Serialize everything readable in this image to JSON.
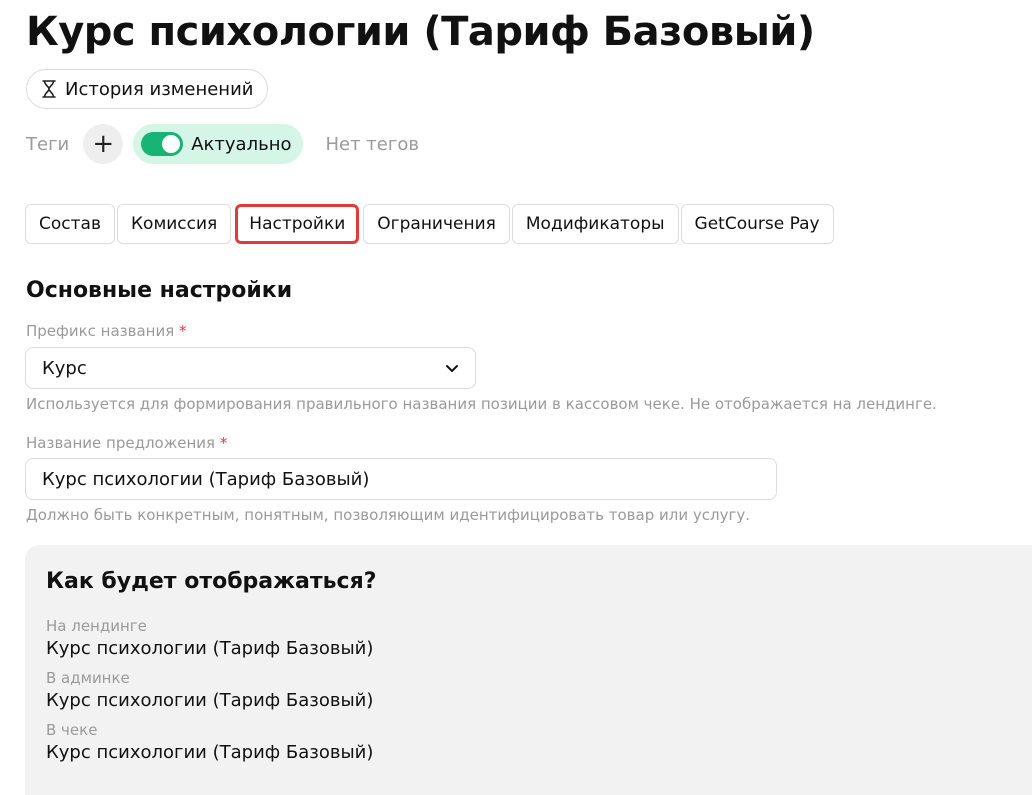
{
  "page": {
    "title": "Курс психологии (Тариф Базовый)"
  },
  "history": {
    "label": "История изменений",
    "icon": "hourglass-icon"
  },
  "tags": {
    "label": "Теги",
    "add_symbol": "+",
    "status_label": "Актуально",
    "status_on": true,
    "empty_text": "Нет тегов",
    "accent_color": "#18b476"
  },
  "tabs": [
    {
      "label": "Состав"
    },
    {
      "label": "Комиссия"
    },
    {
      "label": "Настройки",
      "active": true
    },
    {
      "label": "Ограничения"
    },
    {
      "label": "Модификаторы"
    },
    {
      "label": "GetCourse Pay"
    }
  ],
  "settings": {
    "section_title": "Основные настройки",
    "prefix": {
      "label": "Префикс названия",
      "required_mark": "*",
      "value": "Курс",
      "hint": "Используется для формирования правильного названия позиции в кассовом чеке. Не отображается на лендинге."
    },
    "offer_name": {
      "label": "Название предложения",
      "required_mark": "*",
      "value": "Курс психологии (Тариф Базовый)",
      "hint": "Должно быть конкретным, понятным, позволяющим идентифицировать товар или услугу."
    }
  },
  "preview": {
    "title": "Как будет отображаться?",
    "items": [
      {
        "label": "На лендинге",
        "value": "Курс психологии (Тариф Базовый)"
      },
      {
        "label": "В админке",
        "value": "Курс психологии (Тариф Базовый)"
      },
      {
        "label": "В чеке",
        "value": "Курс психологии (Тариф Базовый)"
      }
    ]
  }
}
